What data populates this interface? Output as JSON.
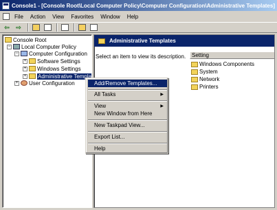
{
  "window": {
    "title": "Console1 - [Console Root\\Local Computer Policy\\Computer Configuration\\Administrative Templates]"
  },
  "menu": [
    "File",
    "Action",
    "View",
    "Favorites",
    "Window",
    "Help"
  ],
  "tree": {
    "console_root": "Console Root",
    "local_policy": "Local Computer Policy",
    "computer_config": "Computer Configuration",
    "software_settings": "Software Settings",
    "windows_settings": "Windows Settings",
    "admin_templates": "Administrative Templates",
    "user_config": "User Configuration"
  },
  "right": {
    "header": "Administrative Templates",
    "description": "Select an item to view its description.",
    "column_header": "Setting",
    "items": [
      "Windows Components",
      "System",
      "Network",
      "Printers"
    ]
  },
  "context_menu": {
    "add_remove": "Add/Remove Templates...",
    "all_tasks": "All Tasks",
    "view": "View",
    "new_window": "New Window from Here",
    "new_taskpad": "New Taskpad View...",
    "export": "Export List...",
    "help": "Help"
  },
  "colors": {
    "highlight": "#0a246a",
    "face": "#d4d0c8",
    "folder": "#f2d35a"
  }
}
